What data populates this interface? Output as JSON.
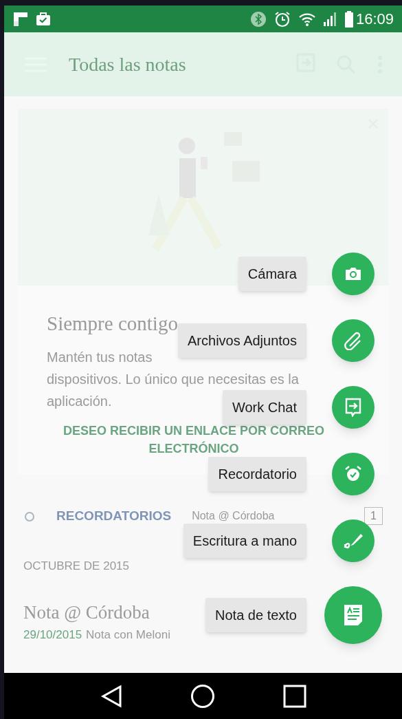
{
  "status_bar": {
    "time": "16:09"
  },
  "toolbar": {
    "title": "Todas las notas"
  },
  "promo_card": {
    "headline": "Siempre contigo",
    "body_lines": [
      "Mantén tus notas",
      "dispositivos. Lo único que necesitas es la",
      "aplicación."
    ],
    "link": "DESEO RECIBIR UN ENLACE POR CORREO ELECTRÓNICO"
  },
  "reminders": {
    "label": "RECORDATORIOS",
    "note": "Nota @ Córdoba",
    "count": "1"
  },
  "section_header": "OCTUBRE DE 2015",
  "notes": [
    {
      "title": "Nota @ Córdoba",
      "date": "29/10/2015",
      "snippet": "Nota con Meloni"
    }
  ],
  "fab_menu": [
    {
      "label": "Cámara",
      "kind": "mini"
    },
    {
      "label": "Archivos Adjuntos",
      "kind": "mini"
    },
    {
      "label": "Work Chat",
      "kind": "mini"
    },
    {
      "label": "Recordatorio",
      "kind": "mini"
    },
    {
      "label": "Escritura a mano",
      "kind": "mini"
    },
    {
      "label": "Nota de texto",
      "kind": "main"
    }
  ]
}
